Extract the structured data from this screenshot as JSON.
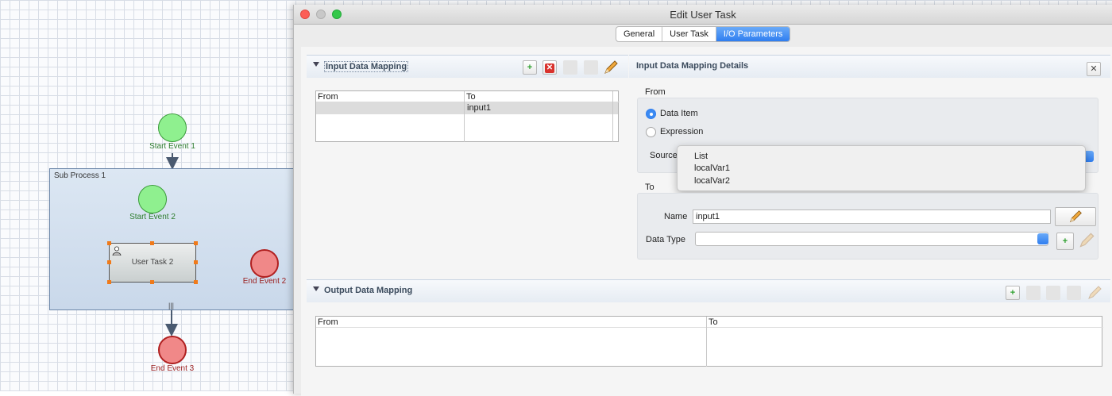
{
  "diagram": {
    "start_event_1": "Start Event 1",
    "subprocess_label": "Sub Process 1",
    "start_event_2": "Start Event 2",
    "user_task_2": "User Task 2",
    "end_event_2": "End Event 2",
    "end_event_3": "End Event 3",
    "multi_instance_marker": "|||"
  },
  "dialog": {
    "title": "Edit User Task",
    "tabs": [
      {
        "label": "General",
        "active": false
      },
      {
        "label": "User Task",
        "active": false
      },
      {
        "label": "I/O Parameters",
        "active": true
      }
    ]
  },
  "input_mapping": {
    "title": "Input Data Mapping",
    "columns": [
      "From",
      "To"
    ],
    "rows": [
      {
        "from": "",
        "to": "input1"
      }
    ]
  },
  "details": {
    "title": "Input Data Mapping Details",
    "from_label": "From",
    "radio_data_item": "Data Item",
    "radio_expression": "Expression",
    "selected_radio": "Data Item",
    "source_label": "Source",
    "source_options": [
      "List",
      "localVar1",
      "localVar2"
    ],
    "to_label": "To",
    "name_label": "Name",
    "name_value": "input1",
    "data_type_label": "Data Type",
    "data_type_value": ""
  },
  "output_mapping": {
    "title": "Output Data Mapping",
    "columns": [
      "From",
      "To"
    ]
  },
  "colors": {
    "accent": "#2f7ef0",
    "start_event": "#8ff08f",
    "end_event": "#f08888",
    "handle": "#f07a1a"
  }
}
